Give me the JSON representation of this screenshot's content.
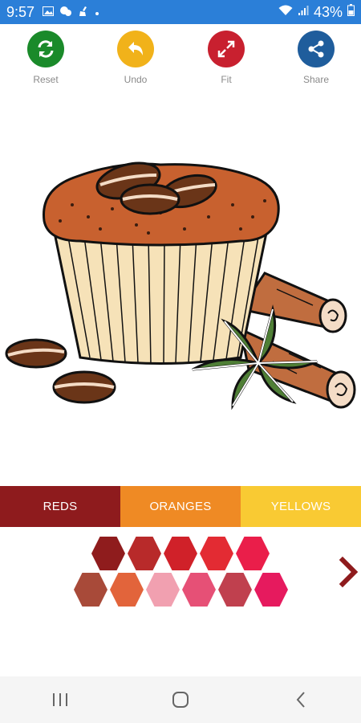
{
  "status": {
    "time": "9:57",
    "battery": "43%",
    "icons": [
      "image-icon",
      "chat-icon",
      "cleaner-icon",
      "dot-icon",
      "wifi-icon",
      "signal-icon",
      "battery-icon"
    ]
  },
  "toolbar": {
    "reset_label": "Reset",
    "undo_label": "Undo",
    "fit_label": "Fit",
    "share_label": "Share",
    "colors": {
      "reset": "#1a8a2a",
      "undo": "#f1b21a",
      "fit": "#c8202f",
      "share": "#1f5d9c"
    }
  },
  "tabs": [
    {
      "label": "REDS",
      "color": "#8e1b1d"
    },
    {
      "label": "ORANGES",
      "color": "#ef8a24"
    },
    {
      "label": "YELLOWS",
      "color": "#f9ca33"
    }
  ],
  "palette": {
    "row1": [
      "#8f1c1d",
      "#b82a2a",
      "#d02129",
      "#e32b33",
      "#ea1e4a"
    ],
    "row2": [
      "#a84a39",
      "#e2643b",
      "#f1a0b0",
      "#e65076",
      "#c0404e",
      "#e61a5e"
    ]
  },
  "nav": {
    "icons": [
      "recents-icon",
      "home-icon",
      "back-icon"
    ]
  }
}
